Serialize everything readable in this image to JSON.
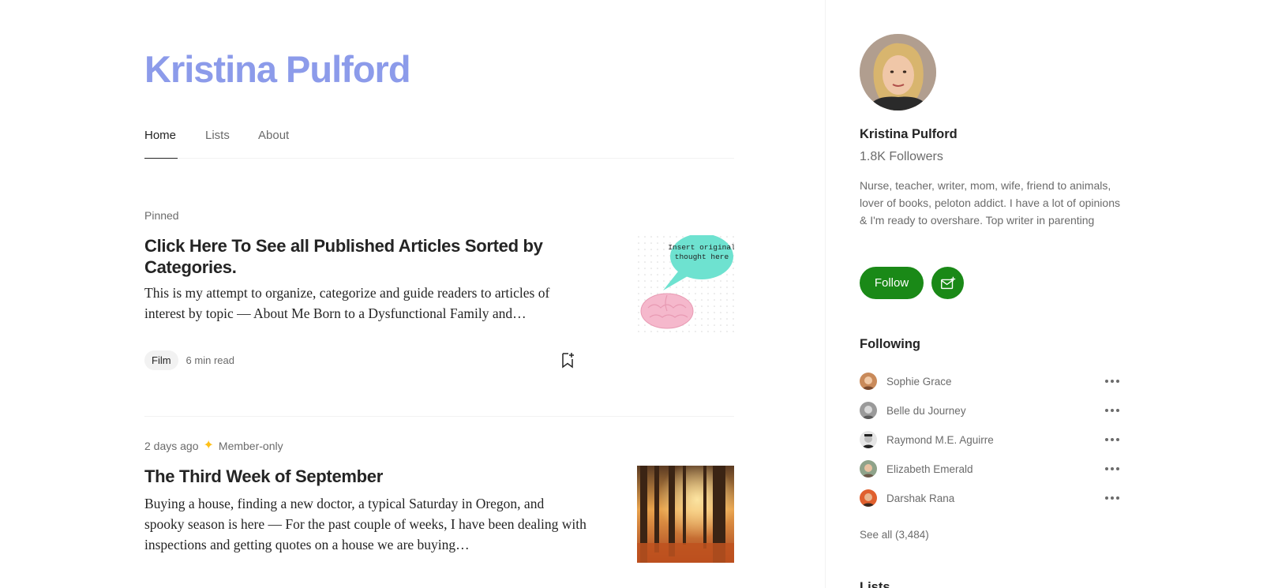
{
  "profile": {
    "name": "Kristina Pulford",
    "followers": "1.8K Followers",
    "bio": "Nurse, teacher, writer, mom, wife, friend to animals, lover of books, peloton addict. I have a lot of opinions & I'm ready to overshare. Top writer in parenting",
    "follow_label": "Follow"
  },
  "tabs": [
    {
      "label": "Home",
      "active": true
    },
    {
      "label": "Lists",
      "active": false
    },
    {
      "label": "About",
      "active": false
    }
  ],
  "articles": [
    {
      "meta": "Pinned",
      "title": "Click Here To See all Published Articles Sorted by Categories.",
      "subtitle": "This is my attempt to organize, categorize and guide readers to articles of interest by topic — About Me Born to a Dysfunctional Family and…",
      "thumb_text": "Insert original thought here",
      "tag": "Film",
      "read_time": "6 min read"
    },
    {
      "date": "2 days ago",
      "member_label": "Member-only",
      "title": "The Third Week of September",
      "subtitle": "Buying a house, finding a new doctor, a typical Saturday in Oregon, and spooky season is here — For the past couple of weeks, I have been dealing with inspections and getting quotes on a house we are buying…"
    }
  ],
  "following": {
    "title": "Following",
    "items": [
      {
        "name": "Sophie Grace"
      },
      {
        "name": "Belle du Journey"
      },
      {
        "name": "Raymond M.E. Aguirre"
      },
      {
        "name": "Elizabeth Emerald"
      },
      {
        "name": "Darshak Rana"
      }
    ],
    "see_all": "See all (3,484)"
  },
  "lists_title": "Lists",
  "colors": {
    "name_accent": "#8c9bea",
    "follow_green": "#1a8917",
    "member_star": "#ffc017"
  }
}
